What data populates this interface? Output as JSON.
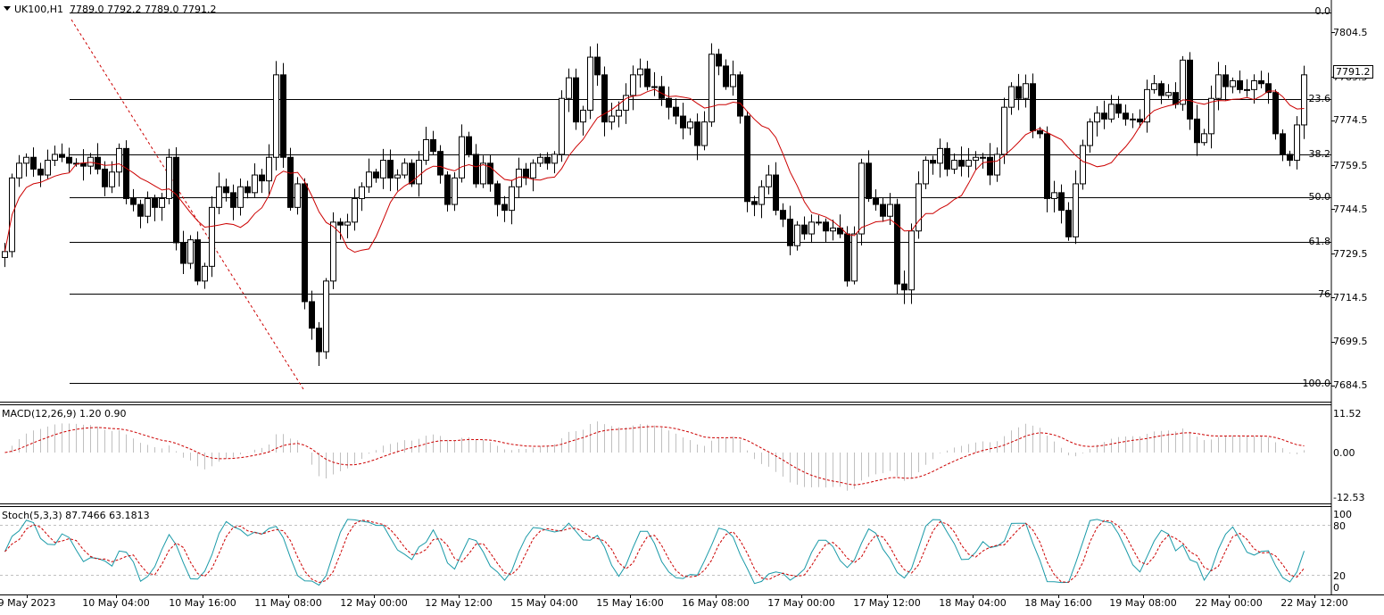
{
  "header": {
    "symbol": "UK100,H1",
    "ohlc": "7789.0 7792.2 7789.0 7791.2"
  },
  "price_axis": [
    "7804.5",
    "7789.5",
    "7774.5",
    "7759.5",
    "7744.5",
    "7729.5",
    "7714.5",
    "7699.5",
    "7684.5"
  ],
  "current_price": "7791.2",
  "fibo_levels": [
    {
      "label": "0.0",
      "price": 7811.2
    },
    {
      "label": "23.6",
      "price": 7781.9
    },
    {
      "label": "38.2",
      "price": 7763.0
    },
    {
      "label": "50.0",
      "price": 7748.4
    },
    {
      "label": "61.8",
      "price": 7733.4
    },
    {
      "label": "76",
      "price": 7715.7
    },
    {
      "label": "100.0",
      "price": 7685.4
    }
  ],
  "macd": {
    "title": "MACD(12,26,9) 1.20 0.90",
    "axis": [
      "11.52",
      "0.00",
      "-12.53"
    ]
  },
  "stoch": {
    "title": "Stoch(5,3,3) 87.7466 63.1813",
    "axis": [
      "100",
      "80",
      "20",
      "0"
    ]
  },
  "time_axis": [
    "9 May 2023",
    "10 May 04:00",
    "10 May 16:00",
    "11 May 08:00",
    "12 May 00:00",
    "12 May 12:00",
    "15 May 04:00",
    "15 May 16:00",
    "16 May 08:00",
    "17 May 00:00",
    "17 May 12:00",
    "18 May 04:00",
    "18 May 16:00",
    "19 May 08:00",
    "22 May 00:00",
    "22 May 12:00"
  ],
  "colors": {
    "ma": "#cc0000",
    "macd_hist": "#c0c0c0",
    "signal": "#cc0000",
    "stoch_main": "#1a9aa8",
    "stoch_signal": "#cc0000",
    "level_line": "#000000"
  },
  "chart_data": {
    "type": "candlestick",
    "y_range": [
      7680,
      7815
    ],
    "ohlc_range_note": "",
    "closes": [
      7730,
      7755,
      7760,
      7762,
      7758,
      7756,
      7761,
      7763,
      7762,
      7760,
      7760,
      7759,
      7762,
      7758,
      7752,
      7757,
      7765,
      7748,
      7746,
      7742,
      7748,
      7745,
      7748,
      7762,
      7733,
      7726,
      7734,
      7720,
      7725,
      7745,
      7752,
      7750,
      7745,
      7752,
      7750,
      7756,
      7754,
      7762,
      7790,
      7762,
      7745,
      7753,
      7713,
      7704,
      7696,
      7720,
      7740,
      7739,
      7740,
      7748,
      7752,
      7757,
      7755,
      7761,
      7755,
      7756,
      7760,
      7753,
      7761,
      7768,
      7764,
      7756,
      7746,
      7755,
      7769,
      7763,
      7753,
      7760,
      7753,
      7746,
      7744,
      7752,
      7758,
      7755,
      7760,
      7762,
      7760,
      7763,
      7782,
      7789,
      7774,
      7778,
      7796,
      7790,
      7774,
      7776,
      7778,
      7783,
      7790,
      7792,
      7786,
      7786,
      7782,
      7779,
      7776,
      7772,
      7774,
      7766,
      7774,
      7797,
      7793,
      7786,
      7790,
      7776,
      7747,
      7746,
      7752,
      7756,
      7744,
      7741,
      7732,
      7739,
      7736,
      7740,
      7740,
      7737,
      7738,
      7736,
      7720,
      7736,
      7760,
      7748,
      7746,
      7742,
      7746,
      7719,
      7717,
      7737,
      7753,
      7761,
      7760,
      7765,
      7758,
      7761,
      7759,
      7761,
      7762,
      7762,
      7756,
      7763,
      7779,
      7786,
      7782,
      7787,
      7771,
      7770,
      7748,
      7750,
      7744,
      7735,
      7753,
      7766,
      7774,
      7777,
      7775,
      7780,
      7777,
      7775,
      7775,
      7774,
      7785,
      7787,
      7783,
      7784,
      7780,
      7795,
      7775,
      7767,
      7770,
      7782,
      7790,
      7786,
      7788,
      7785,
      7785,
      7788,
      7787,
      7784,
      7770,
      7763,
      7761,
      7773,
      7790
    ]
  }
}
